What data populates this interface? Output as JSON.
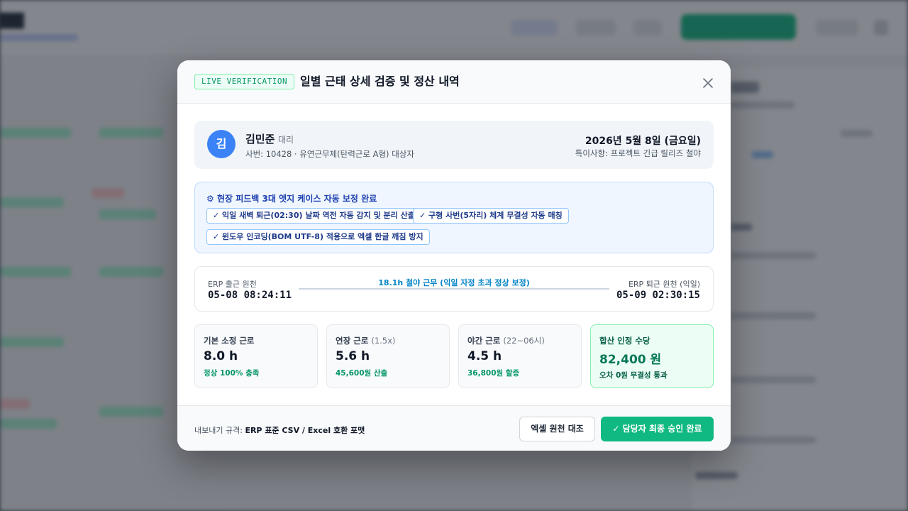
{
  "modal": {
    "badge": "LIVE VERIFICATION",
    "title": "일별 근태 상세 검증 및 정산 내역",
    "close_icon": "close-icon"
  },
  "employee": {
    "avatar_initial": "김",
    "name": "김민준",
    "rank": "대리",
    "meta": "사번: 10428 · 유연근무제(탄력근로 A형) 대상자",
    "date": "2026년 5월 8일 (금요일)",
    "note": "특이사항: 프로젝트 긴급 릴리즈 철야"
  },
  "feedback": {
    "icon": "gear-icon",
    "title": "현장 피드백 3대 엣지 케이스 자동 보정 완료",
    "items": [
      "✓ 익일 새벽 퇴근(02:30) 날짜 역전 자동 감지 및 분리 산출",
      "✓ 구형 사번(5자리) 체계 무결성 자동 매칭",
      "✓ 윈도우 인코딩(BOM UTF-8) 적용으로 엑셀 한글 깨짐 방지"
    ]
  },
  "timeline": {
    "in_label": "ERP 출근 원천",
    "in_time": "05-08 08:24:11",
    "center_label": "18.1h 철야 근무 (익일 자정 초과 정상 보정)",
    "out_label": "ERP 퇴근 원천 (익일)",
    "out_time": "05-09 02:30:15"
  },
  "stats": [
    {
      "label": "기본 소정 근로",
      "sub": "",
      "value": "8.0 h",
      "note": "정상 100% 충족"
    },
    {
      "label": "연장 근로",
      "sub": "(1.5x)",
      "value": "5.6 h",
      "note": "45,600원 산출"
    },
    {
      "label": "야간 근로",
      "sub": "(22~06시)",
      "value": "4.5 h",
      "note": "36,800원 할증"
    },
    {
      "label": "합산 인정 수당",
      "sub": "",
      "value": "82,400 원",
      "note": "오차 0원 무결성 통과"
    }
  ],
  "footer": {
    "export_prefix": "내보내기 규격:",
    "export_format": "ERP 표준 CSV / Excel 호환 포맷",
    "compare_button": "엑셀 원천 대조",
    "approve_button": "✓ 담당자 최종 승인 완료"
  },
  "colors": {
    "accent": "#10b981",
    "avatar": "#3b82f6",
    "info": "#1e40af"
  }
}
